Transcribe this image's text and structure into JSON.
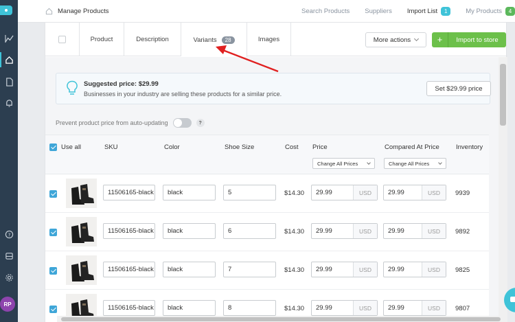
{
  "topbar": {
    "title": "Manage Products",
    "nav": [
      {
        "label": "Search Products"
      },
      {
        "label": "Suppliers"
      },
      {
        "label": "Import List",
        "badge": "1"
      },
      {
        "label": "My Products",
        "badge": "4"
      }
    ]
  },
  "sidebar": {
    "avatar": "RP",
    "icons": [
      "logo-icon",
      "chart-icon",
      "home-icon",
      "document-icon",
      "bell-icon",
      "help-icon",
      "inbox-icon",
      "gear-icon"
    ]
  },
  "tabs": [
    {
      "label": "Product"
    },
    {
      "label": "Description"
    },
    {
      "label": "Variants",
      "count": "28"
    },
    {
      "label": "Images"
    }
  ],
  "actions": {
    "more": "More actions",
    "import": "Import to store"
  },
  "suggest": {
    "title": "Suggested price: $29.99",
    "desc": "Businesses in your industry are selling these products for a similar price.",
    "button": "Set $29.99 price"
  },
  "prevent_label": "Prevent product price from auto-updating",
  "help": "?",
  "table": {
    "headers": {
      "use_all": "Use all",
      "sku": "SKU",
      "color": "Color",
      "shoe_size": "Shoe Size",
      "cost": "Cost",
      "price": "Price",
      "compared": "Compared At Price",
      "inventory": "Inventory"
    },
    "change_all": "Change All Prices",
    "currency": "USD",
    "rows": [
      {
        "sku": "11506165-black",
        "color": "black",
        "size": "5",
        "cost": "$14.30",
        "price": "29.99",
        "compared": "29.99",
        "inventory": "9939"
      },
      {
        "sku": "11506165-black",
        "color": "black",
        "size": "6",
        "cost": "$14.30",
        "price": "29.99",
        "compared": "29.99",
        "inventory": "9892"
      },
      {
        "sku": "11506165-black",
        "color": "black",
        "size": "7",
        "cost": "$14.30",
        "price": "29.99",
        "compared": "29.99",
        "inventory": "9825"
      },
      {
        "sku": "11506165-black",
        "color": "black",
        "size": "8",
        "cost": "$14.30",
        "price": "29.99",
        "compared": "29.99",
        "inventory": "9807"
      }
    ]
  },
  "colors": {
    "accent": "#3fc3d8",
    "sidebar": "#2c3e50",
    "import_button": "#6cc04a",
    "annotation_arrow": "#e02020"
  }
}
